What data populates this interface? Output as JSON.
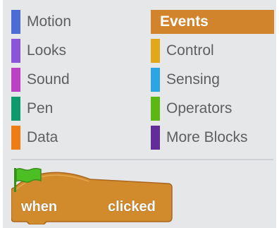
{
  "palette": {
    "categories_left": [
      {
        "label": "Motion",
        "color": "#4a6cd4",
        "icon": "motion-category-swatch"
      },
      {
        "label": "Looks",
        "color": "#8a55d7",
        "icon": "looks-category-swatch"
      },
      {
        "label": "Sound",
        "color": "#bb42c3",
        "icon": "sound-category-swatch"
      },
      {
        "label": "Pen",
        "color": "#0e9a6c",
        "icon": "pen-category-swatch"
      },
      {
        "label": "Data",
        "color": "#ee7d16",
        "icon": "data-category-swatch"
      }
    ],
    "categories_right": [
      {
        "label": "Events",
        "color": "#c88330",
        "selected": true
      },
      {
        "label": "Control",
        "color": "#e1a91a",
        "icon": "control-category-swatch"
      },
      {
        "label": "Sensing",
        "color": "#2ca5e2",
        "icon": "sensing-category-swatch"
      },
      {
        "label": "Operators",
        "color": "#5cb712",
        "icon": "operators-category-swatch"
      },
      {
        "label": "More Blocks",
        "color": "#632d99",
        "icon": "more-blocks-category-swatch"
      }
    ]
  },
  "block": {
    "text_before": "when",
    "icon": "green-flag-icon",
    "text_after": "clicked",
    "color": "#d28b2c",
    "flag_color": "#4cbf25"
  }
}
